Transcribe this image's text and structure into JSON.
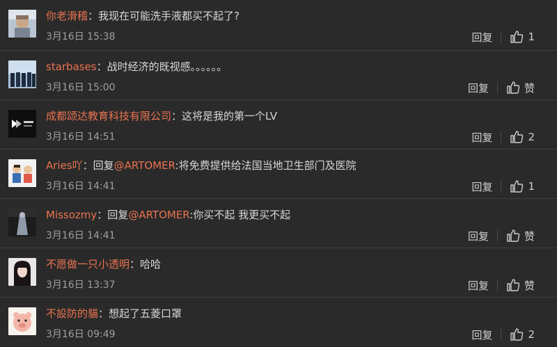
{
  "comments": [
    {
      "username": "你老滑稽",
      "separator": "：",
      "text": "我现在可能洗手液都买不起了?",
      "reply_prefix": "",
      "mention": "",
      "after_mention": "",
      "timestamp": "3月16日 15:38",
      "reply_label": "回复",
      "like_label": "1",
      "avatar_icon": "user-photo-avatar"
    },
    {
      "username": "starbases",
      "separator": "：",
      "text": "战时经济的既视感。。。。。。",
      "reply_prefix": "",
      "mention": "",
      "after_mention": "",
      "timestamp": "3月16日 15:00",
      "reply_label": "回复",
      "like_label": "赞",
      "avatar_icon": "group-photo-avatar"
    },
    {
      "username": "成都颂达教育科技有限公司",
      "separator": "：",
      "text": "这将是我的第一个LV",
      "reply_prefix": "",
      "mention": "",
      "after_mention": "",
      "timestamp": "3月16日 14:51",
      "reply_label": "回复",
      "like_label": "2",
      "avatar_icon": "company-logo-avatar"
    },
    {
      "username": "Aries吖",
      "separator": "：",
      "text": "",
      "reply_prefix": "回复",
      "mention": "@ARTOMER",
      "after_mention": ":将免费提供给法国当地卫生部门及医院",
      "timestamp": "3月16日 14:41",
      "reply_label": "回复",
      "like_label": "1",
      "avatar_icon": "cartoon-avatar"
    },
    {
      "username": "Missozmy",
      "separator": "：",
      "text": "",
      "reply_prefix": "回复",
      "mention": "@ARTOMER",
      "after_mention": ":你买不起 我更买不起",
      "timestamp": "3月16日 14:41",
      "reply_label": "回复",
      "like_label": "赞",
      "avatar_icon": "dark-figure-avatar"
    },
    {
      "username": "不愿做一只小透明",
      "separator": "：",
      "text": "哈哈",
      "reply_prefix": "",
      "mention": "",
      "after_mention": "",
      "timestamp": "3月16日 13:37",
      "reply_label": "回复",
      "like_label": "赞",
      "avatar_icon": "girl-portrait-avatar"
    },
    {
      "username": "不設防的貓",
      "separator": "：",
      "text": "想起了五菱口罩",
      "reply_prefix": "",
      "mention": "",
      "after_mention": "",
      "timestamp": "3月16日 09:49",
      "reply_label": "回复",
      "like_label": "2",
      "avatar_icon": "cartoon-pig-avatar"
    }
  ],
  "colors": {
    "background": "#2a2a2a",
    "username": "#eb7350",
    "text": "#d8d8d8",
    "timestamp": "#a0a0a0",
    "divider": "#3e3e3e"
  }
}
